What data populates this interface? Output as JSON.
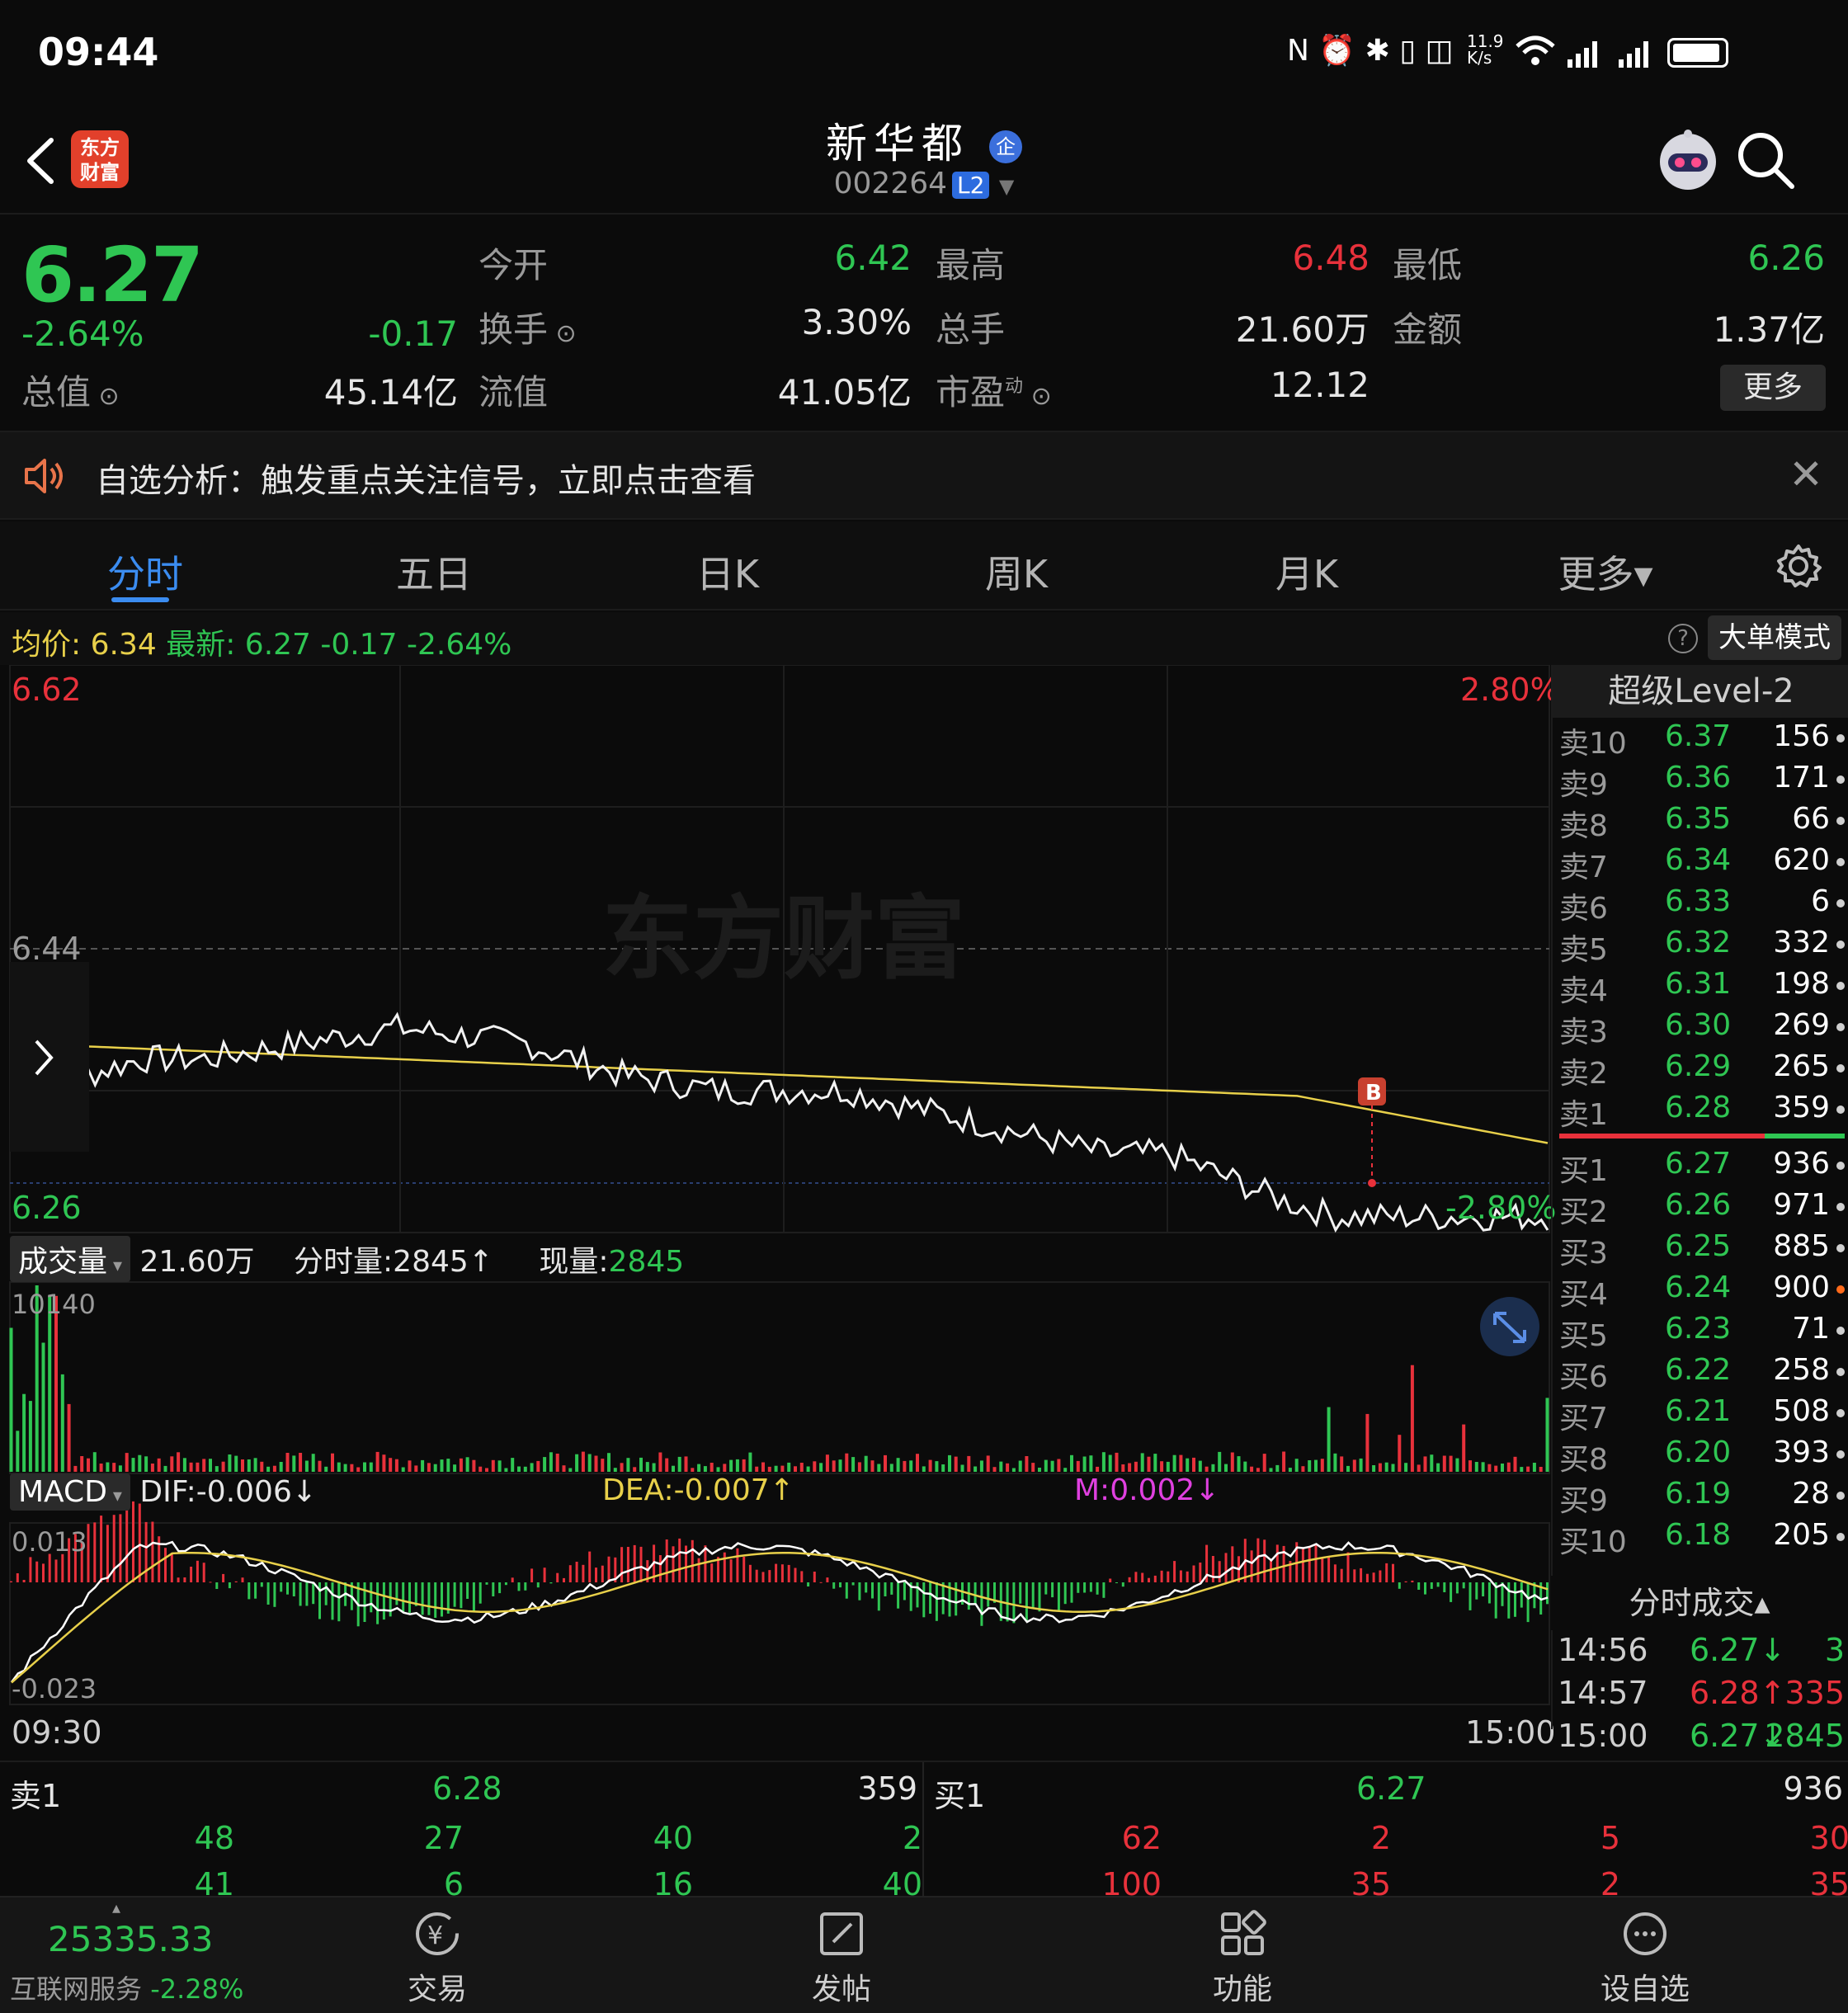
{
  "status_bar": {
    "time": "09:44",
    "icons_text": "N ⏰ ✱ ▯ ◫",
    "net_speed": "11.9 K/s"
  },
  "header": {
    "logo_text_top": "东方",
    "logo_text_bottom": "财富",
    "stock_name": "新华都",
    "enterprise_badge": "企",
    "stock_code": "002264",
    "level_badge": "L2"
  },
  "quote": {
    "price": "6.27",
    "change_pct": "-2.64%",
    "change": "-0.17",
    "open_label": "今开",
    "open": "6.42",
    "high_label": "最高",
    "high": "6.48",
    "low_label": "最低",
    "low": "6.26",
    "turnover_label": "换手",
    "turnover": "3.30%",
    "volume_label": "总手",
    "volume": "21.60万",
    "amount_label": "金额",
    "amount": "1.37亿",
    "mktcap_label": "总值",
    "mktcap": "45.14亿",
    "float_label": "流值",
    "float": "41.05亿",
    "pe_label": "市盈",
    "pe_sup": "动",
    "pe": "12.12",
    "more_label": "更多"
  },
  "notice": {
    "text": "自选分析：触发重点关注信号，立即点击查看"
  },
  "tabs": [
    "分时",
    "五日",
    "日K",
    "周K",
    "月K",
    "更多▾"
  ],
  "avg_bar": {
    "avg_label": "均价:",
    "avg": "6.34",
    "latest_label": "最新:",
    "latest": "6.27",
    "change": "-0.17",
    "change_pct": "-2.64%",
    "big_order_label": "大单模式",
    "help": "?"
  },
  "price_chart": {
    "top_left": "6.62",
    "top_right": "2.80%",
    "mid_left": "6.44",
    "bottom_left": "6.26",
    "bottom_right": "-2.80%",
    "watermark": "东方财富",
    "trade_marker": "B"
  },
  "vol_chart": {
    "label": "成交量",
    "total": "21.60万",
    "tick_label": "分时量:2845↑",
    "now_label": "现量:",
    "now_value": "2845",
    "max": "10140"
  },
  "macd_chart": {
    "label": "MACD",
    "dif": "DIF:-0.006↓",
    "dea": "DEA:-0.007↑",
    "m": "M:0.002↓",
    "max": "0.013",
    "min": "-0.023"
  },
  "time_axis": {
    "start": "09:30",
    "end": "15:00"
  },
  "orderbook": {
    "title": "超级Level-2",
    "asks": [
      {
        "label": "卖10",
        "price": "6.37",
        "vol": "156"
      },
      {
        "label": "卖9",
        "price": "6.36",
        "vol": "171"
      },
      {
        "label": "卖8",
        "price": "6.35",
        "vol": "66"
      },
      {
        "label": "卖7",
        "price": "6.34",
        "vol": "620"
      },
      {
        "label": "卖6",
        "price": "6.33",
        "vol": "6"
      },
      {
        "label": "卖5",
        "price": "6.32",
        "vol": "332"
      },
      {
        "label": "卖4",
        "price": "6.31",
        "vol": "198"
      },
      {
        "label": "卖3",
        "price": "6.30",
        "vol": "269"
      },
      {
        "label": "卖2",
        "price": "6.29",
        "vol": "265"
      },
      {
        "label": "卖1",
        "price": "6.28",
        "vol": "359"
      }
    ],
    "bids": [
      {
        "label": "买1",
        "price": "6.27",
        "vol": "936"
      },
      {
        "label": "买2",
        "price": "6.26",
        "vol": "971"
      },
      {
        "label": "买3",
        "price": "6.25",
        "vol": "885"
      },
      {
        "label": "买4",
        "price": "6.24",
        "vol": "900"
      },
      {
        "label": "买5",
        "price": "6.23",
        "vol": "71"
      },
      {
        "label": "买6",
        "price": "6.22",
        "vol": "258"
      },
      {
        "label": "买7",
        "price": "6.21",
        "vol": "508"
      },
      {
        "label": "买8",
        "price": "6.20",
        "vol": "393"
      },
      {
        "label": "买9",
        "price": "6.19",
        "vol": "28"
      },
      {
        "label": "买10",
        "price": "6.18",
        "vol": "205"
      }
    ],
    "ticks_title": "分时成交▴",
    "ticks": [
      {
        "time": "14:56",
        "price": "6.27↓",
        "vol": "3"
      },
      {
        "time": "14:57",
        "price": "6.28↑",
        "vol": "335"
      },
      {
        "time": "15:00",
        "price": "6.27↓",
        "vol": "2845"
      }
    ]
  },
  "bottom_book": {
    "ask_label": "卖1",
    "ask_price": "6.28",
    "ask_vol": "359",
    "bid_label": "买1",
    "bid_price": "6.27",
    "bid_vol": "936",
    "ask_queue_1": [
      "48",
      "27",
      "40",
      "2"
    ],
    "ask_queue_2": [
      "41",
      "6",
      "16",
      "40"
    ],
    "bid_queue_1": [
      "62",
      "2",
      "5",
      "30"
    ],
    "bid_queue_2": [
      "100",
      "35",
      "2",
      "35"
    ]
  },
  "bottom_nav": {
    "index_value": "25335.33",
    "index_label": "互联网服务",
    "index_change": "-2.28%",
    "items": [
      "交易",
      "发帖",
      "功能",
      "设自选"
    ]
  },
  "colors": {
    "up": "#e8313b",
    "down": "#2fc653",
    "accent": "#3b8cf0",
    "avg_line": "#e8d04a"
  }
}
